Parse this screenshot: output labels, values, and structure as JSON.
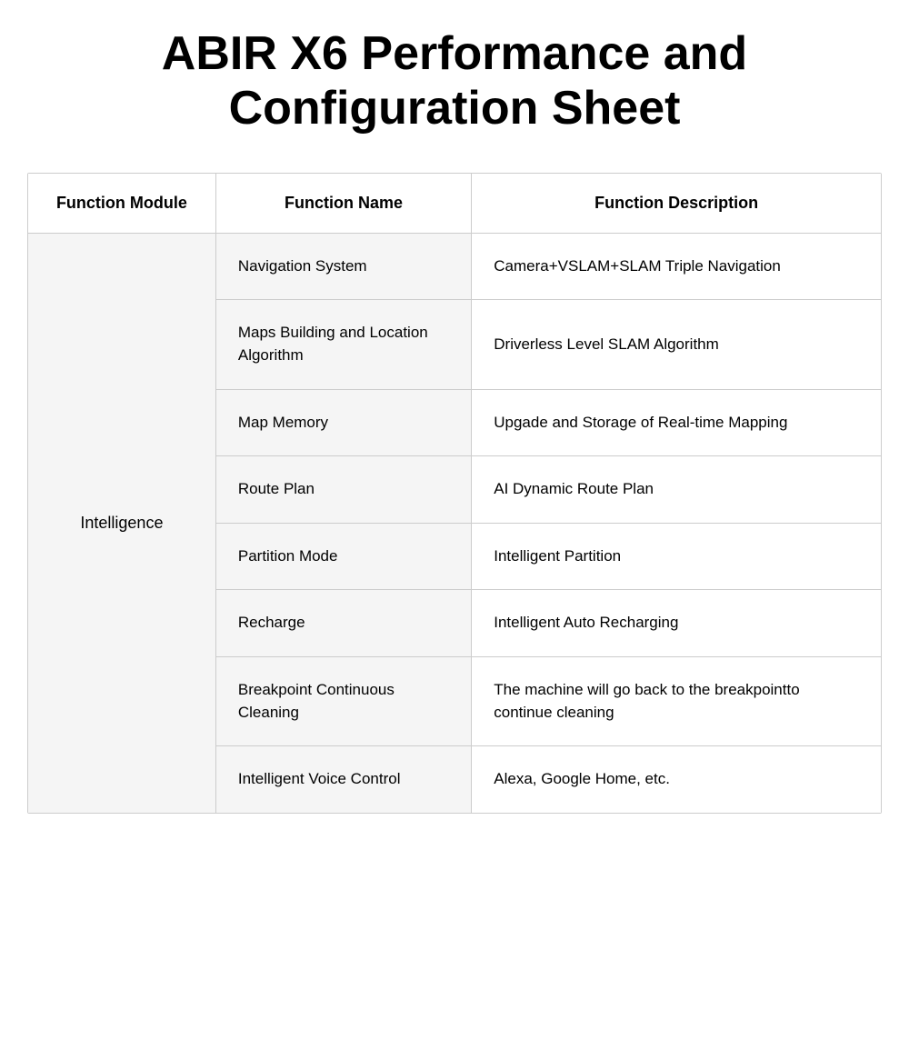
{
  "title": "ABIR X6 Performance and Configuration Sheet",
  "table": {
    "headers": [
      "Function Module",
      "Function Name",
      "Function Description"
    ],
    "rows": [
      {
        "module": "Intelligence",
        "module_rowspan": 8,
        "name": "Navigation System",
        "description": "Camera+VSLAM+SLAM Triple Navigation"
      },
      {
        "name": "Maps Building and Location Algorithm",
        "description": "Driverless Level SLAM Algorithm"
      },
      {
        "name": "Map Memory",
        "description": "Upgade and Storage of Real-time Mapping"
      },
      {
        "name": "Route Plan",
        "description": "AI Dynamic Route Plan"
      },
      {
        "name": "Partition Mode",
        "description": "Intelligent  Partition"
      },
      {
        "name": "Recharge",
        "description": "Intelligent Auto Recharging"
      },
      {
        "name": "Breakpoint Continuous Cleaning",
        "description": "The machine will go back to the breakpointto continue cleaning"
      },
      {
        "name": "Intelligent Voice Control",
        "description": "Alexa, Google Home, etc."
      }
    ]
  }
}
